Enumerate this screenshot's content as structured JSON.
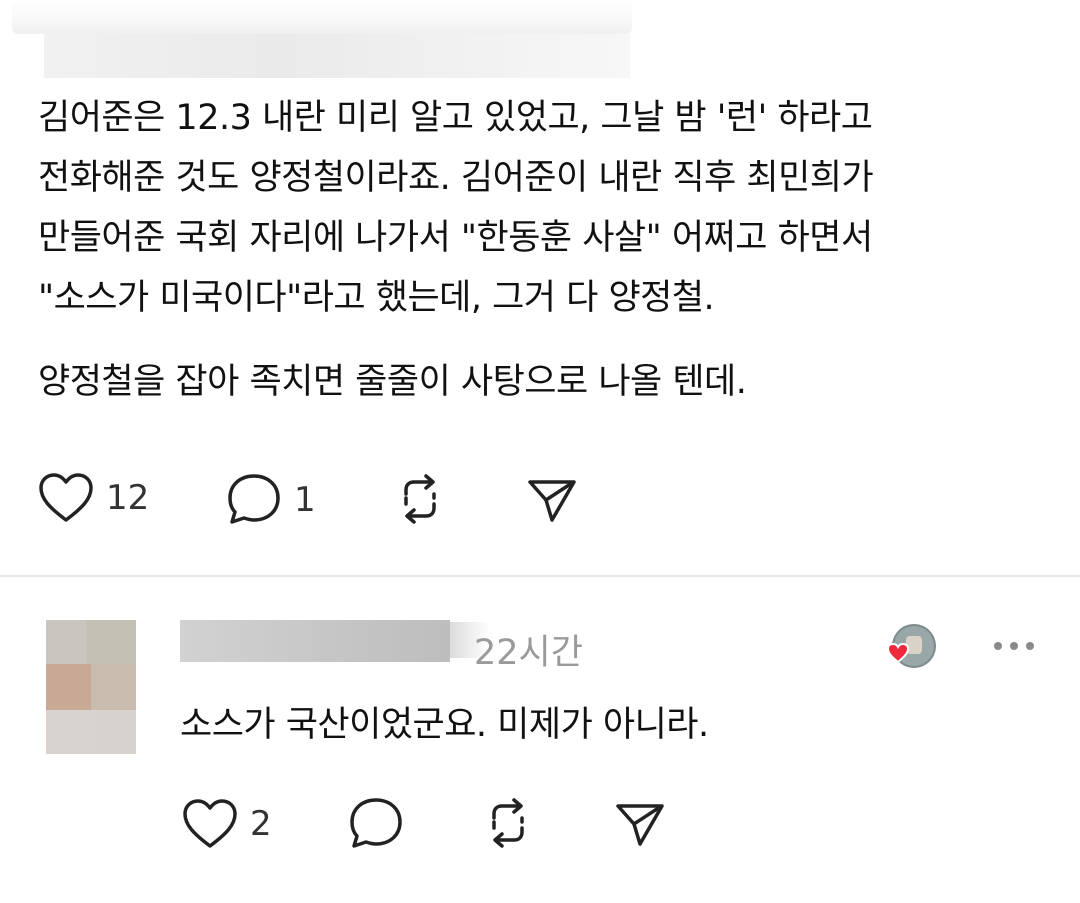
{
  "post": {
    "author_name_blurred": "",
    "paragraphs": [
      "김어준은 12.3 내란 미리 알고 있었고, 그날 밤 '런' 하라고",
      "전화해준 것도 양정철이라죠. 김어준이 내란 직후 최민희가",
      "만들어준 국회 자리에 나가서 \"한동훈 사살\" 어쩌고 하면서",
      "\"소스가 미국이다\"라고 했는데, 그거 다 양정철.",
      "양정철을 잡아 족치면 줄줄이 사탕으로 나올 텐데."
    ],
    "actions": {
      "like_count": "12",
      "reply_count": "1",
      "repost_icon": "repost-icon",
      "share_icon": "send-icon"
    }
  },
  "reply": {
    "time": "22시간",
    "text": "소스가 국산이었군요. 미제가 아니라.",
    "actions": {
      "like_count": "2"
    },
    "author_liked_color": "#ee2a3c"
  }
}
